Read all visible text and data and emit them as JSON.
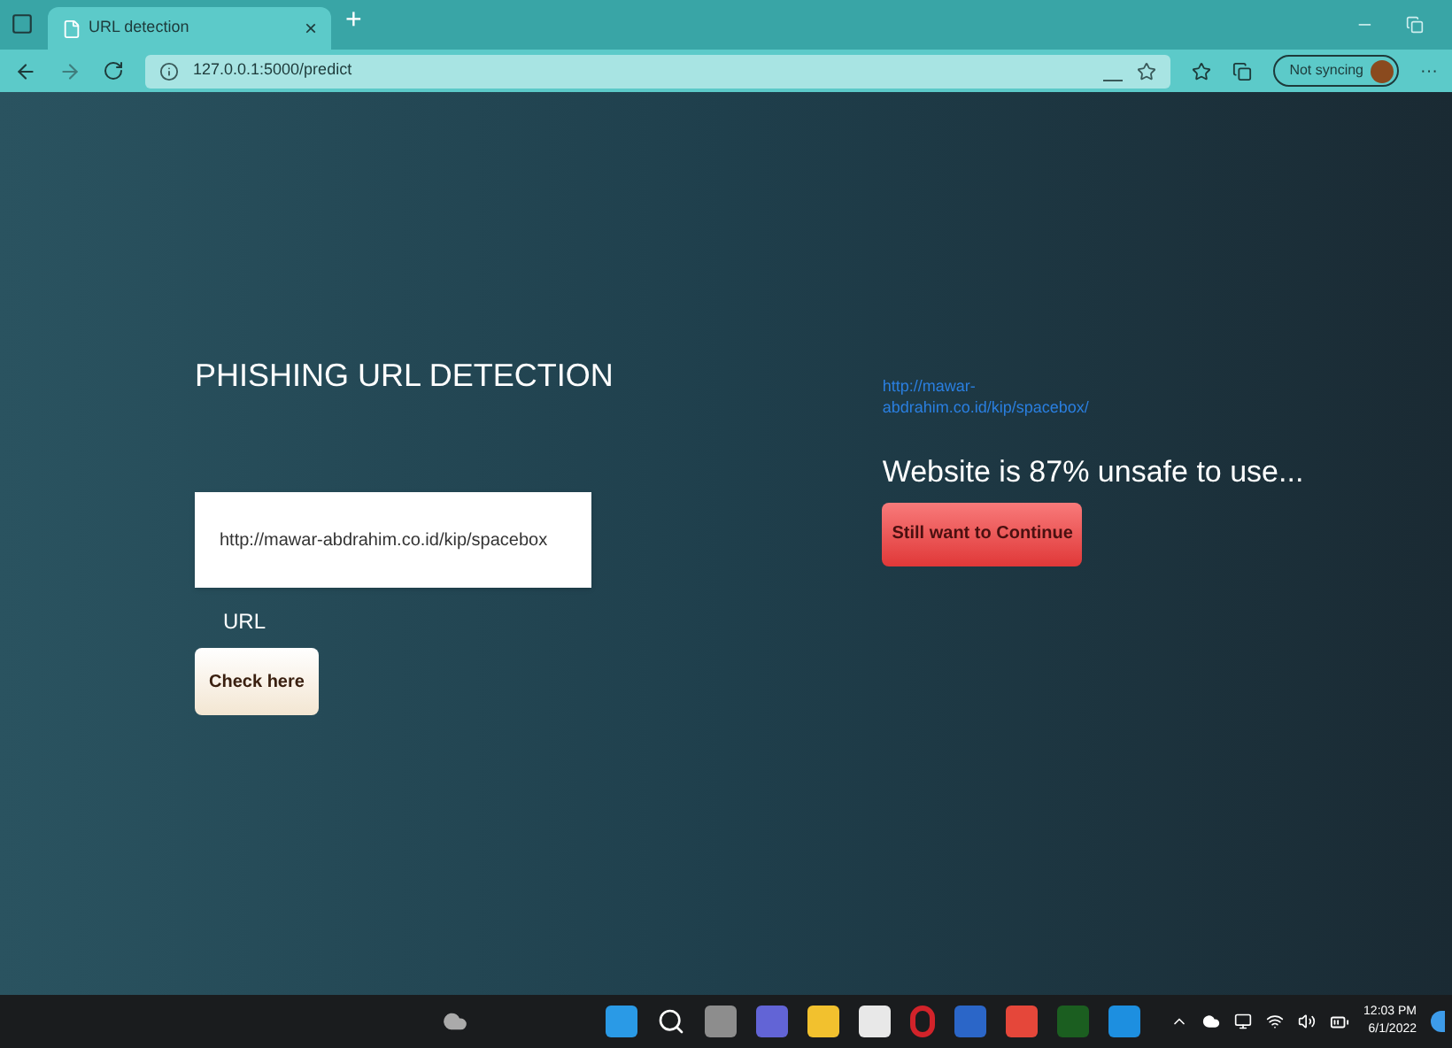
{
  "browser": {
    "tab_title": "URL detection",
    "close_tab": "×",
    "new_tab": "+",
    "address": "127.0.0.1:5000/predict",
    "profile": "Not syncing",
    "minimize": "–",
    "more": "···"
  },
  "page": {
    "title": "PHISHING URL DETECTION",
    "url_field": {
      "value": "http://mawar-abdrahim.co.id/kip/spacebox",
      "label": "URL"
    },
    "check_button": "Check here",
    "result": {
      "link": "http://mawar-abdrahim.co.id/kip/spacebox/",
      "message": "Website is 87% unsafe to use...",
      "continue_button": "Still want to Continue"
    }
  },
  "taskbar": {
    "time": "12:03 PM",
    "date": "6/1/2022"
  }
}
